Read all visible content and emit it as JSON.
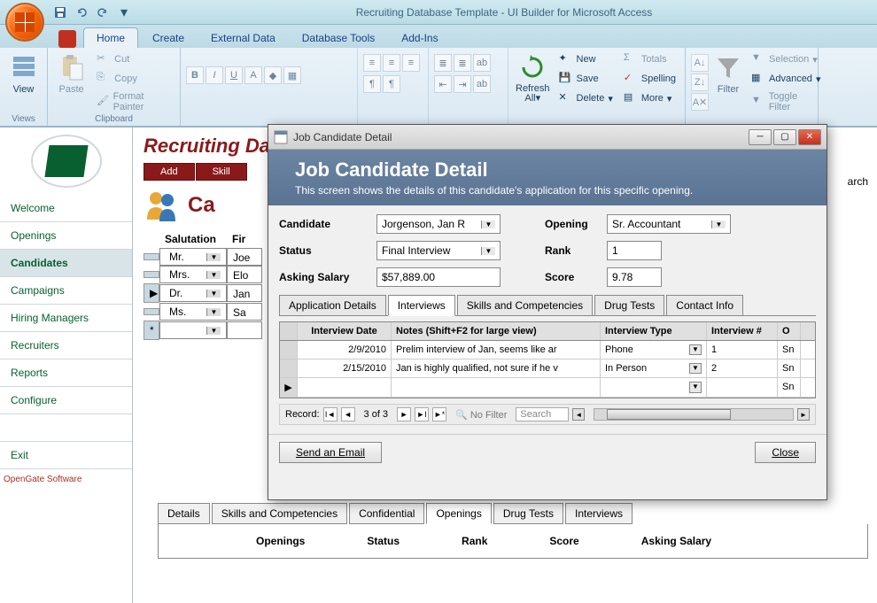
{
  "titlebar": {
    "text": "Recruiting Database Template - UI Builder for Microsoft Access"
  },
  "ribbon_tabs": [
    "Home",
    "Create",
    "External Data",
    "Database Tools",
    "Add-Ins"
  ],
  "ribbon": {
    "views": {
      "view": "View",
      "label": "Views"
    },
    "clipboard": {
      "paste": "Paste",
      "cut": "Cut",
      "copy": "Copy",
      "fp": "Format Painter",
      "label": "Clipboard"
    },
    "records": {
      "refresh": "Refresh\nAll",
      "new": "New",
      "save": "Save",
      "delete": "Delete",
      "totals": "Totals",
      "spelling": "Spelling",
      "more": "More"
    },
    "filter": {
      "filter": "Filter",
      "selection": "Selection",
      "advanced": "Advanced",
      "toggle": "Toggle Filter"
    }
  },
  "sidebar": {
    "items": [
      "Welcome",
      "Openings",
      "Candidates",
      "Campaigns",
      "Hiring Managers",
      "Recruiters",
      "Reports",
      "Configure"
    ],
    "exit": "Exit",
    "foot": "OpenGate Software"
  },
  "content": {
    "title": "Recruiting Databa",
    "toolbar": [
      "Add",
      "Skill"
    ],
    "subtitle": "Ca",
    "search_label": "arch",
    "headers": {
      "sal": "Salutation",
      "fn": "Fir"
    },
    "rows": [
      {
        "sal": "Mr.",
        "fn": "Joe"
      },
      {
        "sal": "Mrs.",
        "fn": "Elo"
      },
      {
        "sal": "Dr.",
        "fn": "Jan"
      },
      {
        "sal": "Ms.",
        "fn": "Sa"
      }
    ],
    "btabs": [
      "Details",
      "Skills and Competencies",
      "Confidential",
      "Openings",
      "Drug Tests",
      "Interviews"
    ],
    "open_cols": [
      "Openings",
      "Status",
      "Rank",
      "Score",
      "Asking Salary"
    ]
  },
  "modal": {
    "tb_title": "Job Candidate Detail",
    "header": {
      "title": "Job Candidate Detail",
      "sub": "This screen shows the details of this candidate's application for this specific opening."
    },
    "fields": {
      "candidate_lbl": "Candidate",
      "candidate": "Jorgenson, Jan R",
      "opening_lbl": "Opening",
      "opening": "Sr. Accountant",
      "status_lbl": "Status",
      "status": "Final Interview",
      "rank_lbl": "Rank",
      "rank": "1",
      "asking_lbl": "Asking Salary",
      "asking": "$57,889.00",
      "score_lbl": "Score",
      "score": "9.78"
    },
    "tabs": [
      "Application Details",
      "Interviews",
      "Skills and Competencies",
      "Drug Tests",
      "Contact Info"
    ],
    "itv": {
      "cols": {
        "date": "Interview Date",
        "notes": "Notes (Shift+F2 for large view)",
        "type": "Interview Type",
        "num": "Interview #",
        "out": "O"
      },
      "rows": [
        {
          "date": "2/9/2010",
          "notes": "Prelim interview of Jan, seems like ar",
          "type": "Phone",
          "num": "1",
          "out": "Sn"
        },
        {
          "date": "2/15/2010",
          "notes": "Jan is highly qualified, not sure if he v",
          "type": "In Person",
          "num": "2",
          "out": "Sn"
        },
        {
          "date": "",
          "notes": "",
          "type": "",
          "num": "",
          "out": "Sn"
        }
      ]
    },
    "recnav": {
      "label": "Record:",
      "pos": "3 of 3",
      "nofilter": "No Filter",
      "search": "Search"
    },
    "footer": {
      "email": "Send an Email",
      "close": "Close"
    }
  }
}
